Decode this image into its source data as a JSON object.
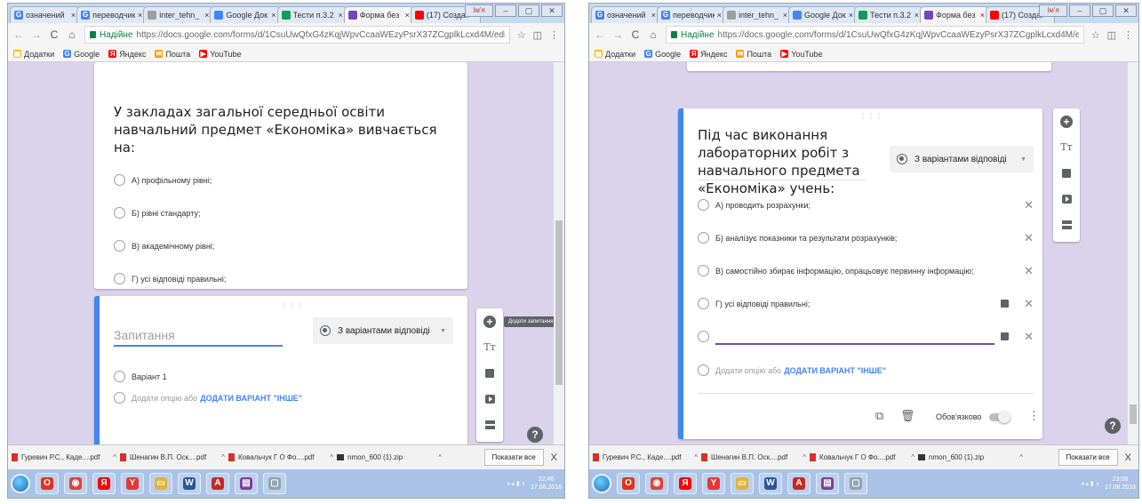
{
  "left": {
    "tabs": [
      {
        "icon": "google-icon",
        "title": "означений",
        "color": "#4285f4",
        "glyph": "G"
      },
      {
        "icon": "google-icon",
        "title": "переводчик",
        "color": "#4285f4",
        "glyph": "G"
      },
      {
        "icon": "page-icon",
        "title": "inter_tehn_",
        "color": "#9e9e9e",
        "glyph": ""
      },
      {
        "icon": "docs-icon",
        "title": "Google Док",
        "color": "#4285f4",
        "glyph": ""
      },
      {
        "icon": "drive-icon",
        "title": "Тести п.3.2",
        "color": "#0f9d58",
        "glyph": ""
      },
      {
        "icon": "forms-icon",
        "title": "Форма без",
        "color": "#7248b9",
        "glyph": ""
      },
      {
        "icon": "youtube-icon",
        "title": "(17) Создан",
        "color": "#ff0000",
        "glyph": ""
      }
    ],
    "address": {
      "secure_label": "Надійне",
      "url": "https://docs.google.com/forms/d/1CsuUwQfxG4zKqjWpvCcaaWEzyPsrX37ZCgplkLcxd4M/edit"
    },
    "bookmarks": [
      {
        "label": "Додатки",
        "icon": "apps-icon",
        "color": "#f4b400",
        "glyph": "▦"
      },
      {
        "label": "Google",
        "icon": "google-icon",
        "color": "#4285f4",
        "glyph": "G"
      },
      {
        "label": "Яндекс",
        "icon": "yandex-icon",
        "color": "#ff0000",
        "glyph": "Я"
      },
      {
        "label": "Пошта",
        "icon": "mail-icon",
        "color": "#ff9800",
        "glyph": "✉"
      },
      {
        "label": "YouTube",
        "icon": "youtube-icon",
        "color": "#ff0000",
        "glyph": "▶"
      }
    ],
    "question1": {
      "text": "У закладах загальної середньої освіти навчальний предмет «Економіка» вивчається на:",
      "options": [
        "А) профільному рівні;",
        "Б) рівні стандарту;",
        "В) академічному рівні;",
        "Г) усі відповіді правильні;"
      ]
    },
    "question2": {
      "placeholder": "Запитання",
      "type_label": "З варіантами відповіді",
      "option": "Варіант 1",
      "add_option": "Додати опцію",
      "or": "або",
      "add_other": "ДОДАТИ ВАРІАНТ \"ІНШЕ\""
    },
    "tooltip": "Додати запитання",
    "clock": {
      "time": "22:46",
      "date": "17.08.2018"
    }
  },
  "right": {
    "tabs": [
      {
        "icon": "google-icon",
        "title": "означений",
        "color": "#4285f4",
        "glyph": "G"
      },
      {
        "icon": "google-icon",
        "title": "переводчик",
        "color": "#4285f4",
        "glyph": "G"
      },
      {
        "icon": "page-icon",
        "title": "inter_tehn_",
        "color": "#9e9e9e",
        "glyph": ""
      },
      {
        "icon": "docs-icon",
        "title": "Google Док",
        "color": "#4285f4",
        "glyph": ""
      },
      {
        "icon": "drive-icon",
        "title": "Тести п.3.2",
        "color": "#0f9d58",
        "glyph": ""
      },
      {
        "icon": "forms-icon",
        "title": "Форма без",
        "color": "#7248b9",
        "glyph": ""
      },
      {
        "icon": "youtube-icon",
        "title": "(17) Создан",
        "color": "#ff0000",
        "glyph": ""
      }
    ],
    "address": {
      "secure_label": "Надійне",
      "url": "https://docs.google.com/forms/d/1CsuUwQfxG4zKqjWpvCcaaWEzyPsrX37ZCgplkLcxd4M/edit"
    },
    "bookmarks": [
      {
        "label": "Додатки",
        "icon": "apps-icon",
        "color": "#f4b400",
        "glyph": "▦"
      },
      {
        "label": "Google",
        "icon": "google-icon",
        "color": "#4285f4",
        "glyph": "G"
      },
      {
        "label": "Яндекс",
        "icon": "yandex-icon",
        "color": "#ff0000",
        "glyph": "Я"
      },
      {
        "label": "Пошта",
        "icon": "mail-icon",
        "color": "#ff9800",
        "glyph": "✉"
      },
      {
        "label": "YouTube",
        "icon": "youtube-icon",
        "color": "#ff0000",
        "glyph": "▶"
      }
    ],
    "question": {
      "text": "Під час виконання лабораторних робіт з навчального предмета «Економіка» учень:",
      "type_label": "З варіантами відповіді",
      "options": [
        "А) проводить розрахунки;",
        "Б) аналізує показники та результати розрахунків;",
        "В) самостійно збирає інформацію, опрацьовує первинну інформацію;",
        "Г) усі відповіді правильні;"
      ],
      "add_option": "Додати опцію",
      "or": "або",
      "add_other": "ДОДАТИ ВАРІАНТ \"ІНШЕ\"",
      "required_label": "Обов'язково"
    },
    "clock": {
      "time": "23:08",
      "date": "17.08.2018"
    }
  },
  "downloads": {
    "items": [
      {
        "name": "Гуревич Р.С., Каде....pdf",
        "type": "pdf"
      },
      {
        "name": "Шенагин В.П. Оск....pdf",
        "type": "pdf"
      },
      {
        "name": "Ковальчук Г О Фо....pdf",
        "type": "pdf"
      },
      {
        "name": "nmon_600 (1).zip",
        "type": "zip"
      }
    ],
    "show_all": "Показати все"
  },
  "taskbar_apps": [
    {
      "icon": "opera-icon",
      "color": "#e1321b",
      "glyph": "O"
    },
    {
      "icon": "chrome-icon",
      "color": "#db4437",
      "glyph": "◉"
    },
    {
      "icon": "yandex-icon",
      "color": "#ff0000",
      "glyph": "Я"
    },
    {
      "icon": "yandex-browser-icon",
      "color": "#e53935",
      "glyph": "Y"
    },
    {
      "icon": "explorer-folder-icon",
      "color": "#e2b33c",
      "glyph": "▭"
    },
    {
      "icon": "word-icon",
      "color": "#2b579a",
      "glyph": "W"
    },
    {
      "icon": "acrobat-icon",
      "color": "#c62828",
      "glyph": "A"
    },
    {
      "icon": "winrar-icon",
      "color": "#7b3f99",
      "glyph": "▤"
    },
    {
      "icon": "window-icon",
      "color": "#90a4ae",
      "glyph": "▢"
    }
  ],
  "colors": {
    "accent": "#4285f4",
    "form_bg": "#dbd2ec",
    "link": "#4285f4"
  },
  "window_user_label": "Ім'я"
}
